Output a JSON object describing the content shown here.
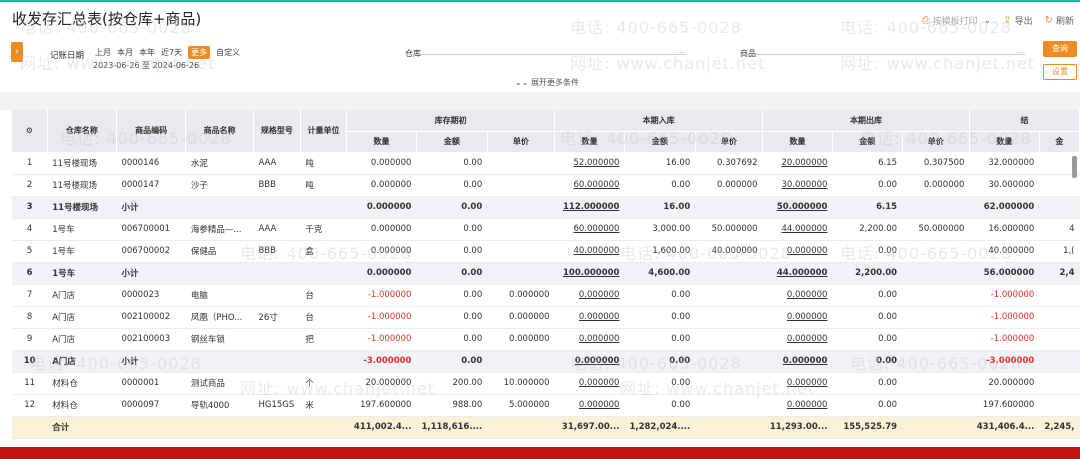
{
  "title": "收发存汇总表(按仓库+商品)",
  "toolbar": {
    "print_label": "按模板打印",
    "export_label": "导出",
    "refresh_label": "刷新"
  },
  "filters": {
    "date_label": "记账日期",
    "periods": [
      "上月",
      "本月",
      "本年",
      "近7天",
      "更多",
      "自定义"
    ],
    "date_range": "2023-06-26 至 2024-06-26",
    "warehouse_label": "仓库",
    "product_label": "商品",
    "dots": "...",
    "query_button": "查询",
    "settings_button": "设置",
    "expand_label": "展开更多条件"
  },
  "watermark": {
    "phone": "电话: 400-665-0028",
    "site": "网址: www.chanjet.net"
  },
  "table": {
    "fixed_headers": [
      "仓库名称",
      "商品编码",
      "商品名称",
      "规格型号",
      "计量单位"
    ],
    "groups": [
      "库存期初",
      "本期入库",
      "本期出库",
      "结"
    ],
    "sub_headers": [
      "数量",
      "金额",
      "单价",
      "数量",
      "金额",
      "单价",
      "数量",
      "金额",
      "单价",
      "数量",
      "金"
    ],
    "rows": [
      {
        "idx": "1",
        "type": "row",
        "cells": [
          "11号楼现场",
          "0000146",
          "水泥",
          "AAA",
          "吨",
          "0.000000",
          "0.00",
          "",
          "52.000000",
          "16.00",
          "0.307692",
          "20.000000",
          "6.15",
          "0.307500",
          "32.000000",
          ""
        ]
      },
      {
        "idx": "2",
        "type": "row",
        "cells": [
          "11号楼现场",
          "0000147",
          "沙子",
          "BBB",
          "吨",
          "0.000000",
          "0.00",
          "",
          "60.000000",
          "0.00",
          "0.000000",
          "30.000000",
          "0.00",
          "0.000000",
          "30.000000",
          ""
        ]
      },
      {
        "idx": "3",
        "type": "sub",
        "cells": [
          "11号楼现场",
          "小计",
          "",
          "",
          "",
          "0.000000",
          "0.00",
          "",
          "112.000000",
          "16.00",
          "",
          "50.000000",
          "6.15",
          "",
          "62.000000",
          ""
        ]
      },
      {
        "idx": "4",
        "type": "row",
        "cells": [
          "1号车",
          "006700001",
          "海参精品—...",
          "AAA",
          "千克",
          "0.000000",
          "0.00",
          "",
          "60.000000",
          "3,000.00",
          "50.000000",
          "44.000000",
          "2,200.00",
          "50.000000",
          "16.000000",
          "4"
        ]
      },
      {
        "idx": "5",
        "type": "row",
        "cells": [
          "1号车",
          "006700002",
          "保健品",
          "BBB",
          "盒",
          "0.000000",
          "0.00",
          "",
          "40.000000",
          "1,600.00",
          "40.000000",
          "0.000000",
          "0.00",
          "",
          "40.000000",
          "1,("
        ]
      },
      {
        "idx": "6",
        "type": "sub",
        "cells": [
          "1号车",
          "小计",
          "",
          "",
          "",
          "0.000000",
          "0.00",
          "",
          "100.000000",
          "4,600.00",
          "",
          "44.000000",
          "2,200.00",
          "",
          "56.000000",
          "2,4"
        ]
      },
      {
        "idx": "7",
        "type": "row",
        "cells": [
          "A门店",
          "0000023",
          "电脑",
          "",
          "台",
          "-1.000000",
          "0.00",
          "0.000000",
          "0.000000",
          "0.00",
          "",
          "0.000000",
          "0.00",
          "",
          "-1.000000",
          ""
        ]
      },
      {
        "idx": "8",
        "type": "row",
        "cells": [
          "A门店",
          "002100002",
          "凤凰（PHO...",
          "26寸",
          "台",
          "-1.000000",
          "0.00",
          "0.000000",
          "0.000000",
          "0.00",
          "",
          "0.000000",
          "0.00",
          "",
          "-1.000000",
          ""
        ]
      },
      {
        "idx": "9",
        "type": "row",
        "cells": [
          "A门店",
          "002100003",
          "钢丝车锁",
          "",
          "把",
          "-1.000000",
          "0.00",
          "0.000000",
          "0.000000",
          "0.00",
          "",
          "0.000000",
          "0.00",
          "",
          "-1.000000",
          ""
        ]
      },
      {
        "idx": "10",
        "type": "sub",
        "cells": [
          "A门店",
          "小计",
          "",
          "",
          "",
          "-3.000000",
          "0.00",
          "",
          "0.000000",
          "0.00",
          "",
          "0.000000",
          "0.00",
          "",
          "-3.000000",
          ""
        ]
      },
      {
        "idx": "11",
        "type": "row",
        "cells": [
          "材料仓",
          "0000001",
          "测试商品",
          "",
          "个",
          "20.000000",
          "200.00",
          "10.000000",
          "0.000000",
          "0.00",
          "",
          "0.000000",
          "0.00",
          "",
          "20.000000",
          ""
        ]
      },
      {
        "idx": "12",
        "type": "row",
        "cells": [
          "材料仓",
          "0000097",
          "导轨4000",
          "HG15GS",
          "米",
          "197.600000",
          "988.00",
          "5.000000",
          "0.000000",
          "0.00",
          "",
          "0.000000",
          "0.00",
          "",
          "197.600000",
          ""
        ]
      }
    ],
    "total": {
      "label": "合计",
      "cells": [
        "",
        "",
        "",
        "",
        "",
        "411,002.4...",
        "1,118,616....",
        "",
        "31,697.00...",
        "1,282,024....",
        "",
        "11,293.00...",
        "155,525.79",
        "",
        "431,406.4...",
        "2,245,"
      ]
    }
  }
}
